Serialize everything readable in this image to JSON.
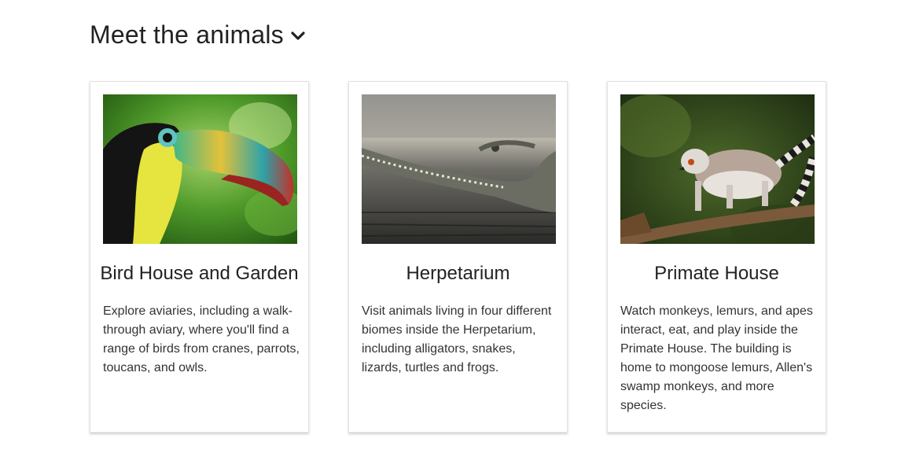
{
  "section": {
    "title": "Meet the animals",
    "toggle_icon": "chevron-down-icon"
  },
  "cards": [
    {
      "title": "Bird House and Garden",
      "description": "Explore aviaries, including a walk-through aviary, where you'll find a range of birds from cranes, parrots, toucans, and owls.",
      "image": "toucan-photo"
    },
    {
      "title": "Herpetarium",
      "description": "Visit animals living in four different biomes inside the Herpetarium, including alligators, snakes, lizards, turtles and frogs.",
      "image": "gharial-photo"
    },
    {
      "title": "Primate House",
      "description": "Watch monkeys, lemurs, and apes interact, eat, and play inside the Primate House. The building is home to mongoose lemurs, Allen's swamp monkeys, and more species.",
      "image": "lemur-photo"
    }
  ]
}
